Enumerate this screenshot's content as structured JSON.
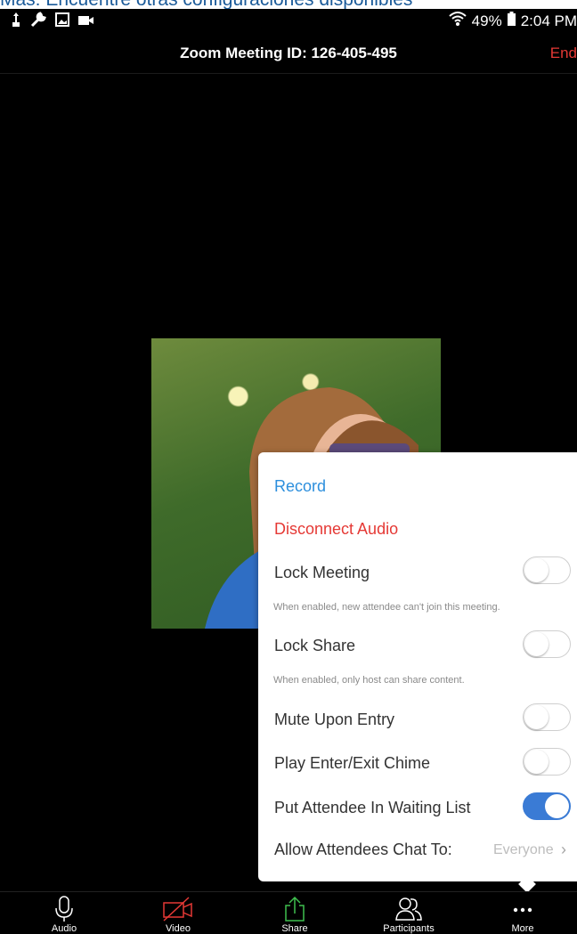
{
  "caption": "Más: Encuentre otras configuraciones disponibles",
  "status_bar": {
    "icons": [
      "usb-icon",
      "wrench-icon",
      "image-icon",
      "video-camera-icon"
    ],
    "battery": "49%",
    "time": "2:04 PM"
  },
  "header": {
    "title": "Zoom Meeting ID: 126-405-495",
    "end_label": "End"
  },
  "popup": {
    "record_label": "Record",
    "disconnect_audio_label": "Disconnect Audio",
    "lock_meeting_label": "Lock Meeting",
    "lock_meeting_hint": "When enabled, new attendee can't join this meeting.",
    "lock_share_label": "Lock Share",
    "lock_share_hint": "When enabled, only host can share content.",
    "mute_upon_entry_label": "Mute Upon Entry",
    "play_chime_label": "Play Enter/Exit Chime",
    "waiting_list_label": "Put Attendee In Waiting List",
    "chat_label": "Allow Attendees Chat To:",
    "chat_value": "Everyone",
    "toggles": {
      "lock_meeting": false,
      "lock_share": false,
      "mute_upon_entry": false,
      "play_chime": false,
      "waiting_list": true
    }
  },
  "toolbar": {
    "audio_label": "Audio",
    "video_label": "Video",
    "share_label": "Share",
    "participants_label": "Participants",
    "more_label": "More"
  },
  "colors": {
    "link_blue": "#2d8fdd",
    "danger_red": "#e53935",
    "toggle_on": "#3a7bd5",
    "share_green": "#3fbf4f"
  }
}
